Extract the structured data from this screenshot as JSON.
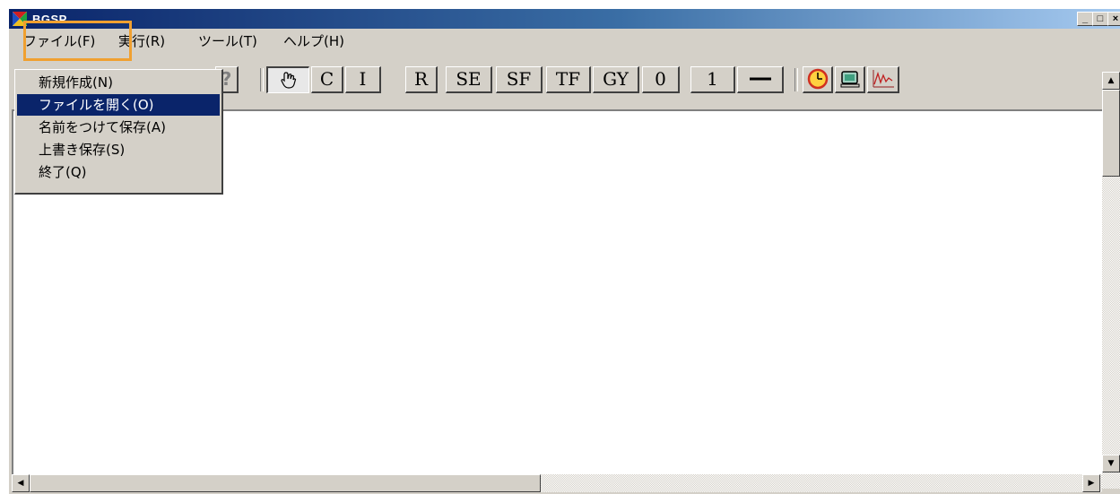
{
  "window": {
    "title": "BGSP",
    "minimize": "_",
    "maximize": "□",
    "close": "×"
  },
  "menubar": {
    "items": [
      {
        "label": "ファイル(F)"
      },
      {
        "label": "実行(R)"
      },
      {
        "label": "ツール(T)"
      },
      {
        "label": "ヘルプ(H)"
      }
    ]
  },
  "file_menu": {
    "items": [
      {
        "label": "新規作成(N)",
        "selected": false
      },
      {
        "label": "ファイルを開く(O)",
        "selected": true
      },
      {
        "label": "名前をつけて保存(A)",
        "selected": false
      },
      {
        "label": "上書き保存(S)",
        "selected": false
      },
      {
        "label": "終了(Q)",
        "selected": false
      }
    ]
  },
  "toolbar": {
    "help_icon": "?",
    "element_buttons": [
      "C",
      "I",
      "R",
      "SE",
      "SF",
      "TF",
      "GY",
      "0",
      "1"
    ],
    "pointer_icon": "hand-pointer-icon",
    "bond_icon": "bond-line-icon",
    "run_icon": "clock-icon",
    "display_icon": "monitor-icon",
    "graph_icon": "graph-icon"
  },
  "colors": {
    "accent_highlight": "#f0a030",
    "menu_selected_bg": "#0a246a",
    "window_face": "#d4d0c8"
  }
}
